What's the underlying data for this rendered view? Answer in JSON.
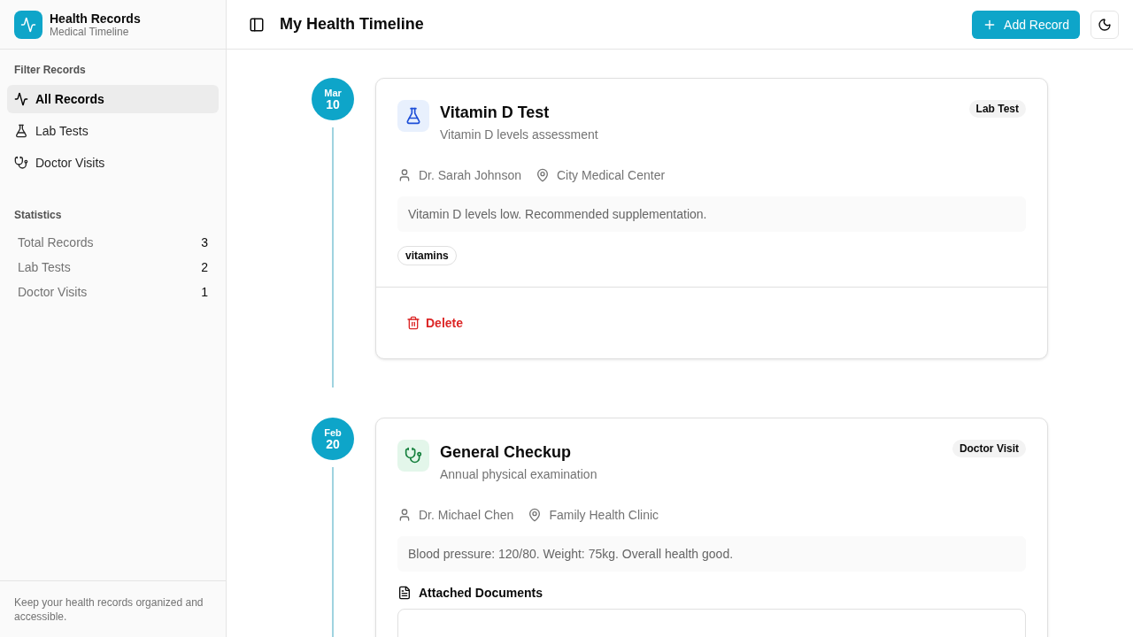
{
  "brand": {
    "title": "Health Records",
    "subtitle": "Medical Timeline"
  },
  "filters": {
    "heading": "Filter Records",
    "items": [
      {
        "kind": "all",
        "label": "All Records",
        "selected": true
      },
      {
        "kind": "lab",
        "label": "Lab Tests",
        "selected": false
      },
      {
        "kind": "visit",
        "label": "Doctor Visits",
        "selected": false
      }
    ]
  },
  "statistics": {
    "heading": "Statistics",
    "items": [
      {
        "label": "Total Records",
        "value": "3"
      },
      {
        "label": "Lab Tests",
        "value": "2"
      },
      {
        "label": "Doctor Visits",
        "value": "1"
      }
    ]
  },
  "sidebar_footer": "Keep your health records organized and accessible.",
  "header": {
    "title": "My Health Timeline",
    "add_button": "Add Record"
  },
  "records": [
    {
      "kind": "lab",
      "month": "Mar",
      "day": "10",
      "title": "Vitamin D Test",
      "description": "Vitamin D levels assessment",
      "badge": "Lab Test",
      "doctor": "Dr. Sarah Johnson",
      "location": "City Medical Center",
      "notes": "Vitamin D levels low. Recommended supplementation.",
      "tags": [
        "vitamins"
      ],
      "delete_label": "Delete"
    },
    {
      "kind": "visit",
      "month": "Feb",
      "day": "20",
      "title": "General Checkup",
      "description": "Annual physical examination",
      "badge": "Doctor Visit",
      "doctor": "Dr. Michael Chen",
      "location": "Family Health Clinic",
      "notes": "Blood pressure: 120/80. Weight: 75kg. Overall health good.",
      "documents_heading": "Attached Documents"
    }
  ]
}
